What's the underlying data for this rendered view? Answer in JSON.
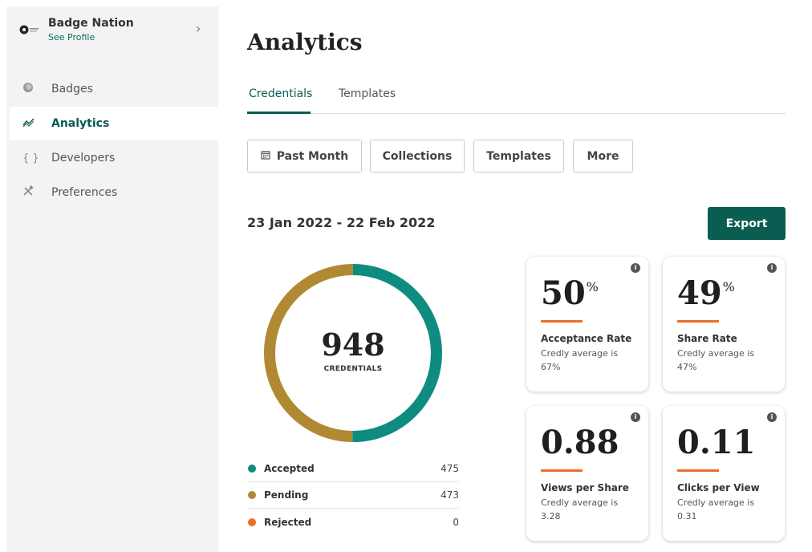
{
  "sidebar": {
    "org_name": "Badge Nation",
    "org_link": "See Profile",
    "items": [
      {
        "label": "Badges",
        "icon": "badge-icon"
      },
      {
        "label": "Analytics",
        "icon": "analytics-icon",
        "active": true
      },
      {
        "label": "Developers",
        "icon": "code-braces-icon"
      },
      {
        "label": "Preferences",
        "icon": "tools-icon"
      }
    ]
  },
  "header": {
    "title": "Analytics"
  },
  "tabs": [
    {
      "label": "Credentials",
      "active": true
    },
    {
      "label": "Templates"
    }
  ],
  "filters": {
    "past_month": "Past Month",
    "collections": "Collections",
    "templates": "Templates",
    "more": "More"
  },
  "date_range": "23 Jan 2022 - 22 Feb 2022",
  "export_label": "Export",
  "donut": {
    "total": "948",
    "label": "CREDENTIALS",
    "segments": [
      {
        "label": "Accepted",
        "value": 475,
        "color": "#0e8c80"
      },
      {
        "label": "Pending",
        "value": 473,
        "color": "#b08a33"
      },
      {
        "label": "Rejected",
        "value": 0,
        "color": "#e8702a"
      }
    ]
  },
  "metrics": [
    {
      "value": "50",
      "suffix": "%",
      "title": "Acceptance Rate",
      "desc": "Credly average is 67%"
    },
    {
      "value": "49",
      "suffix": "%",
      "title": "Share Rate",
      "desc": "Credly average is 47%"
    },
    {
      "value": "0.88",
      "suffix": "",
      "title": "Views per Share",
      "desc": "Credly average is 3.28"
    },
    {
      "value": "0.11",
      "suffix": "",
      "title": "Clicks per View",
      "desc": "Credly average is 0.31"
    }
  ],
  "info_glyph": "i",
  "colors": {
    "accent": "#0b5d52",
    "orange": "#e8702a"
  }
}
